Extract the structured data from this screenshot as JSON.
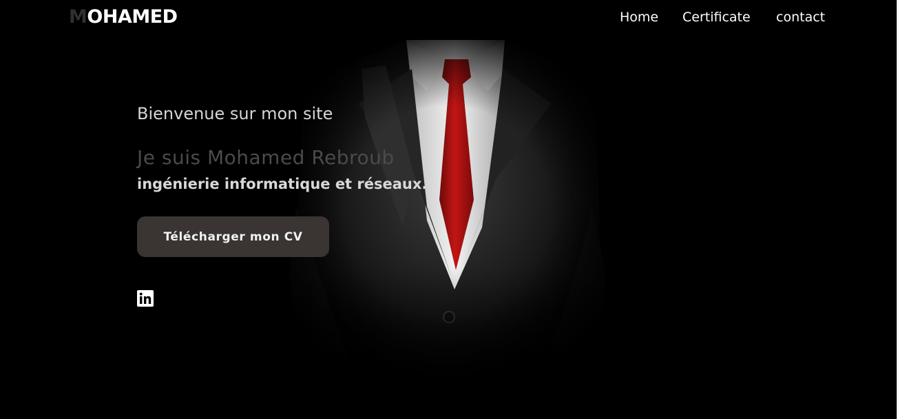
{
  "header": {
    "logo_first": "M",
    "logo_rest": "OHAMED",
    "nav": [
      "Home",
      "Certificate",
      "contact"
    ]
  },
  "hero": {
    "welcome": "Bienvenue sur mon site",
    "name": "Je suis Mohamed Rebroub",
    "role": "ingénierie informatique et réseaux.",
    "cv_button": "Télécharger mon CV",
    "social_icon": "linkedin-icon"
  },
  "colors": {
    "background": "#000000",
    "logo_first_letter": "#2d3136",
    "button_bg": "#3a3433",
    "tie": "#b01010",
    "shirt": "#e9e9e9"
  }
}
